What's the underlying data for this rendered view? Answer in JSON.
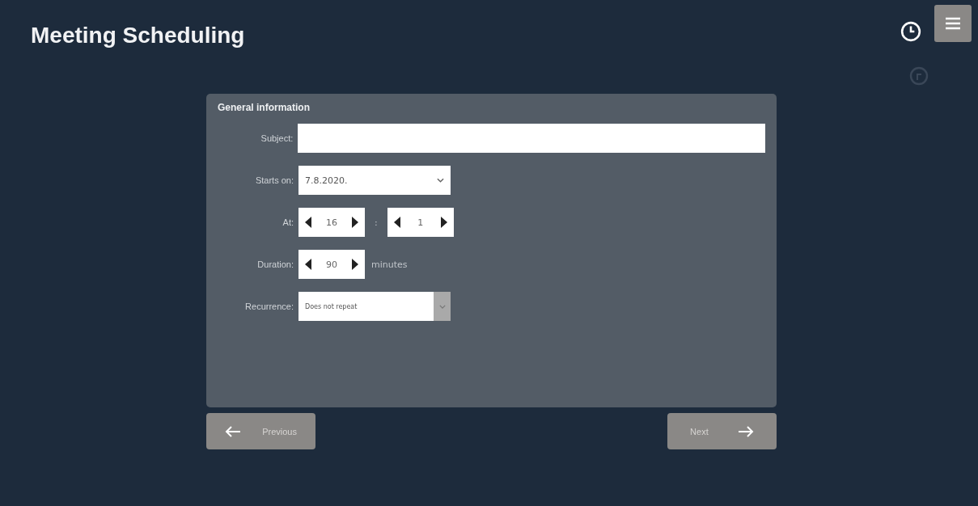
{
  "title": "Meeting Scheduling",
  "section_title": "General information",
  "fields": [
    {
      "kind": "text",
      "label": "Subject:"
    },
    {
      "kind": "date",
      "label": "Starts on:",
      "value": "7.8.2020."
    },
    {
      "kind": "time",
      "label": "At:",
      "hour": "16",
      "separator": ":",
      "minute": "1"
    },
    {
      "kind": "number",
      "label": "Duration:",
      "value": "90",
      "unit": "minutes"
    },
    {
      "kind": "select",
      "label": "Recurrence:",
      "value": "Does not repeat"
    }
  ],
  "buttons": [
    {
      "kind": "previous",
      "label": "Previous",
      "disabled": true
    },
    {
      "kind": "next",
      "label": "Next",
      "disabled": true
    }
  ]
}
